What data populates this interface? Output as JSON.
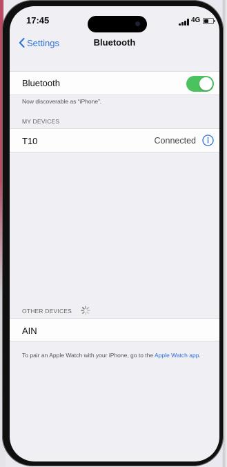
{
  "status_bar": {
    "time": "17:45",
    "network": "4G",
    "signal_icon": "signal-bars-icon",
    "battery_icon": "battery-icon"
  },
  "nav": {
    "back_label": "Settings",
    "title": "Bluetooth",
    "back_icon": "chevron-left-icon"
  },
  "bluetooth": {
    "label": "Bluetooth",
    "toggle_on": true,
    "discoverable_text": "Now discoverable as “iPhone”."
  },
  "my_devices": {
    "header": "MY DEVICES",
    "items": [
      {
        "name": "T10",
        "status": "Connected",
        "icon": "info-icon"
      }
    ]
  },
  "other_devices": {
    "header": "OTHER DEVICES",
    "spinner_icon": "loading-spinner-icon",
    "items": [
      {
        "name": "AIN"
      }
    ]
  },
  "footer": {
    "text": "To pair an Apple Watch with your iPhone, go to the",
    "link": "Apple Watch app",
    "end": "."
  },
  "colors": {
    "accent": "#2f6fd8",
    "toggle_on": "#4cc25f",
    "background": "#efeff4"
  }
}
